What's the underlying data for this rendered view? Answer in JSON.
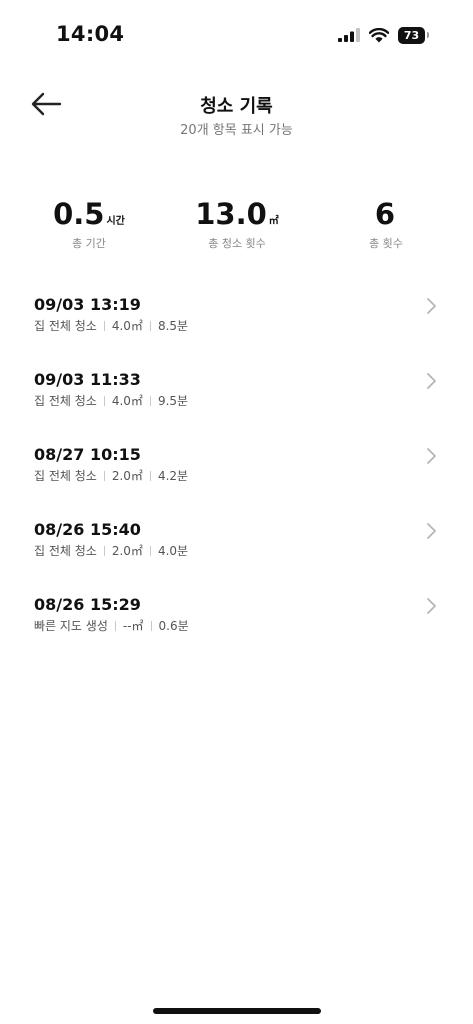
{
  "status_bar": {
    "time": "14:04",
    "battery": "73"
  },
  "header": {
    "title": "청소 기록",
    "subtitle": "20개 항목 표시 가능"
  },
  "summary": [
    {
      "value": "0.5",
      "unit": "시간",
      "label": "총 기간"
    },
    {
      "value": "13.0",
      "unit": "㎡",
      "label": "총 청소 횟수"
    },
    {
      "value": "6",
      "unit": "",
      "label": "총 횟수"
    }
  ],
  "records": [
    {
      "date": "09/03 13:19",
      "mode": "집 전체 청소",
      "area": "4.0㎡",
      "duration": "8.5분"
    },
    {
      "date": "09/03 11:33",
      "mode": "집 전체 청소",
      "area": "4.0㎡",
      "duration": "9.5분"
    },
    {
      "date": "08/27 10:15",
      "mode": "집 전체 청소",
      "area": "2.0㎡",
      "duration": "4.2분"
    },
    {
      "date": "08/26 15:40",
      "mode": "집 전체 청소",
      "area": "2.0㎡",
      "duration": "4.0분"
    },
    {
      "date": "08/26 15:29",
      "mode": "빠른 지도 생성",
      "area": "--㎡",
      "duration": "0.6분"
    }
  ],
  "icons": {
    "back": "arrow-left-icon",
    "signal": "cellular-signal-icon",
    "wifi": "wifi-icon",
    "battery": "battery-icon",
    "chevron": "chevron-right-icon"
  },
  "colors": {
    "text": "#111111",
    "secondary": "#777777",
    "chevron": "#b5b5b5"
  }
}
